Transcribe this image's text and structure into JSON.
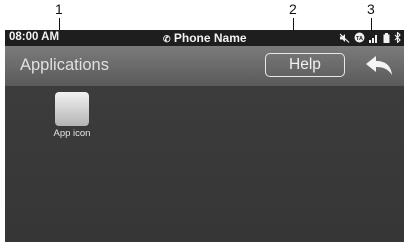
{
  "callouts": [
    "1",
    "2",
    "3"
  ],
  "status_bar": {
    "time": "08:00 AM",
    "phone_icon": "bluetooth-phone-icon",
    "phone_name": "Phone Name",
    "icons": [
      "mute-icon",
      "traffic-announcement-icon",
      "signal-icon",
      "battery-icon",
      "bluetooth-icon"
    ]
  },
  "header": {
    "title": "Applications",
    "help_label": "Help",
    "back_icon": "back-arrow-icon"
  },
  "apps": [
    {
      "label": "App icon"
    }
  ],
  "colors": {
    "status_bar": "#1e1e1e",
    "title_bar": "#6a6a6a",
    "background": "#3a3a3a",
    "text": "#f2f2f2"
  }
}
